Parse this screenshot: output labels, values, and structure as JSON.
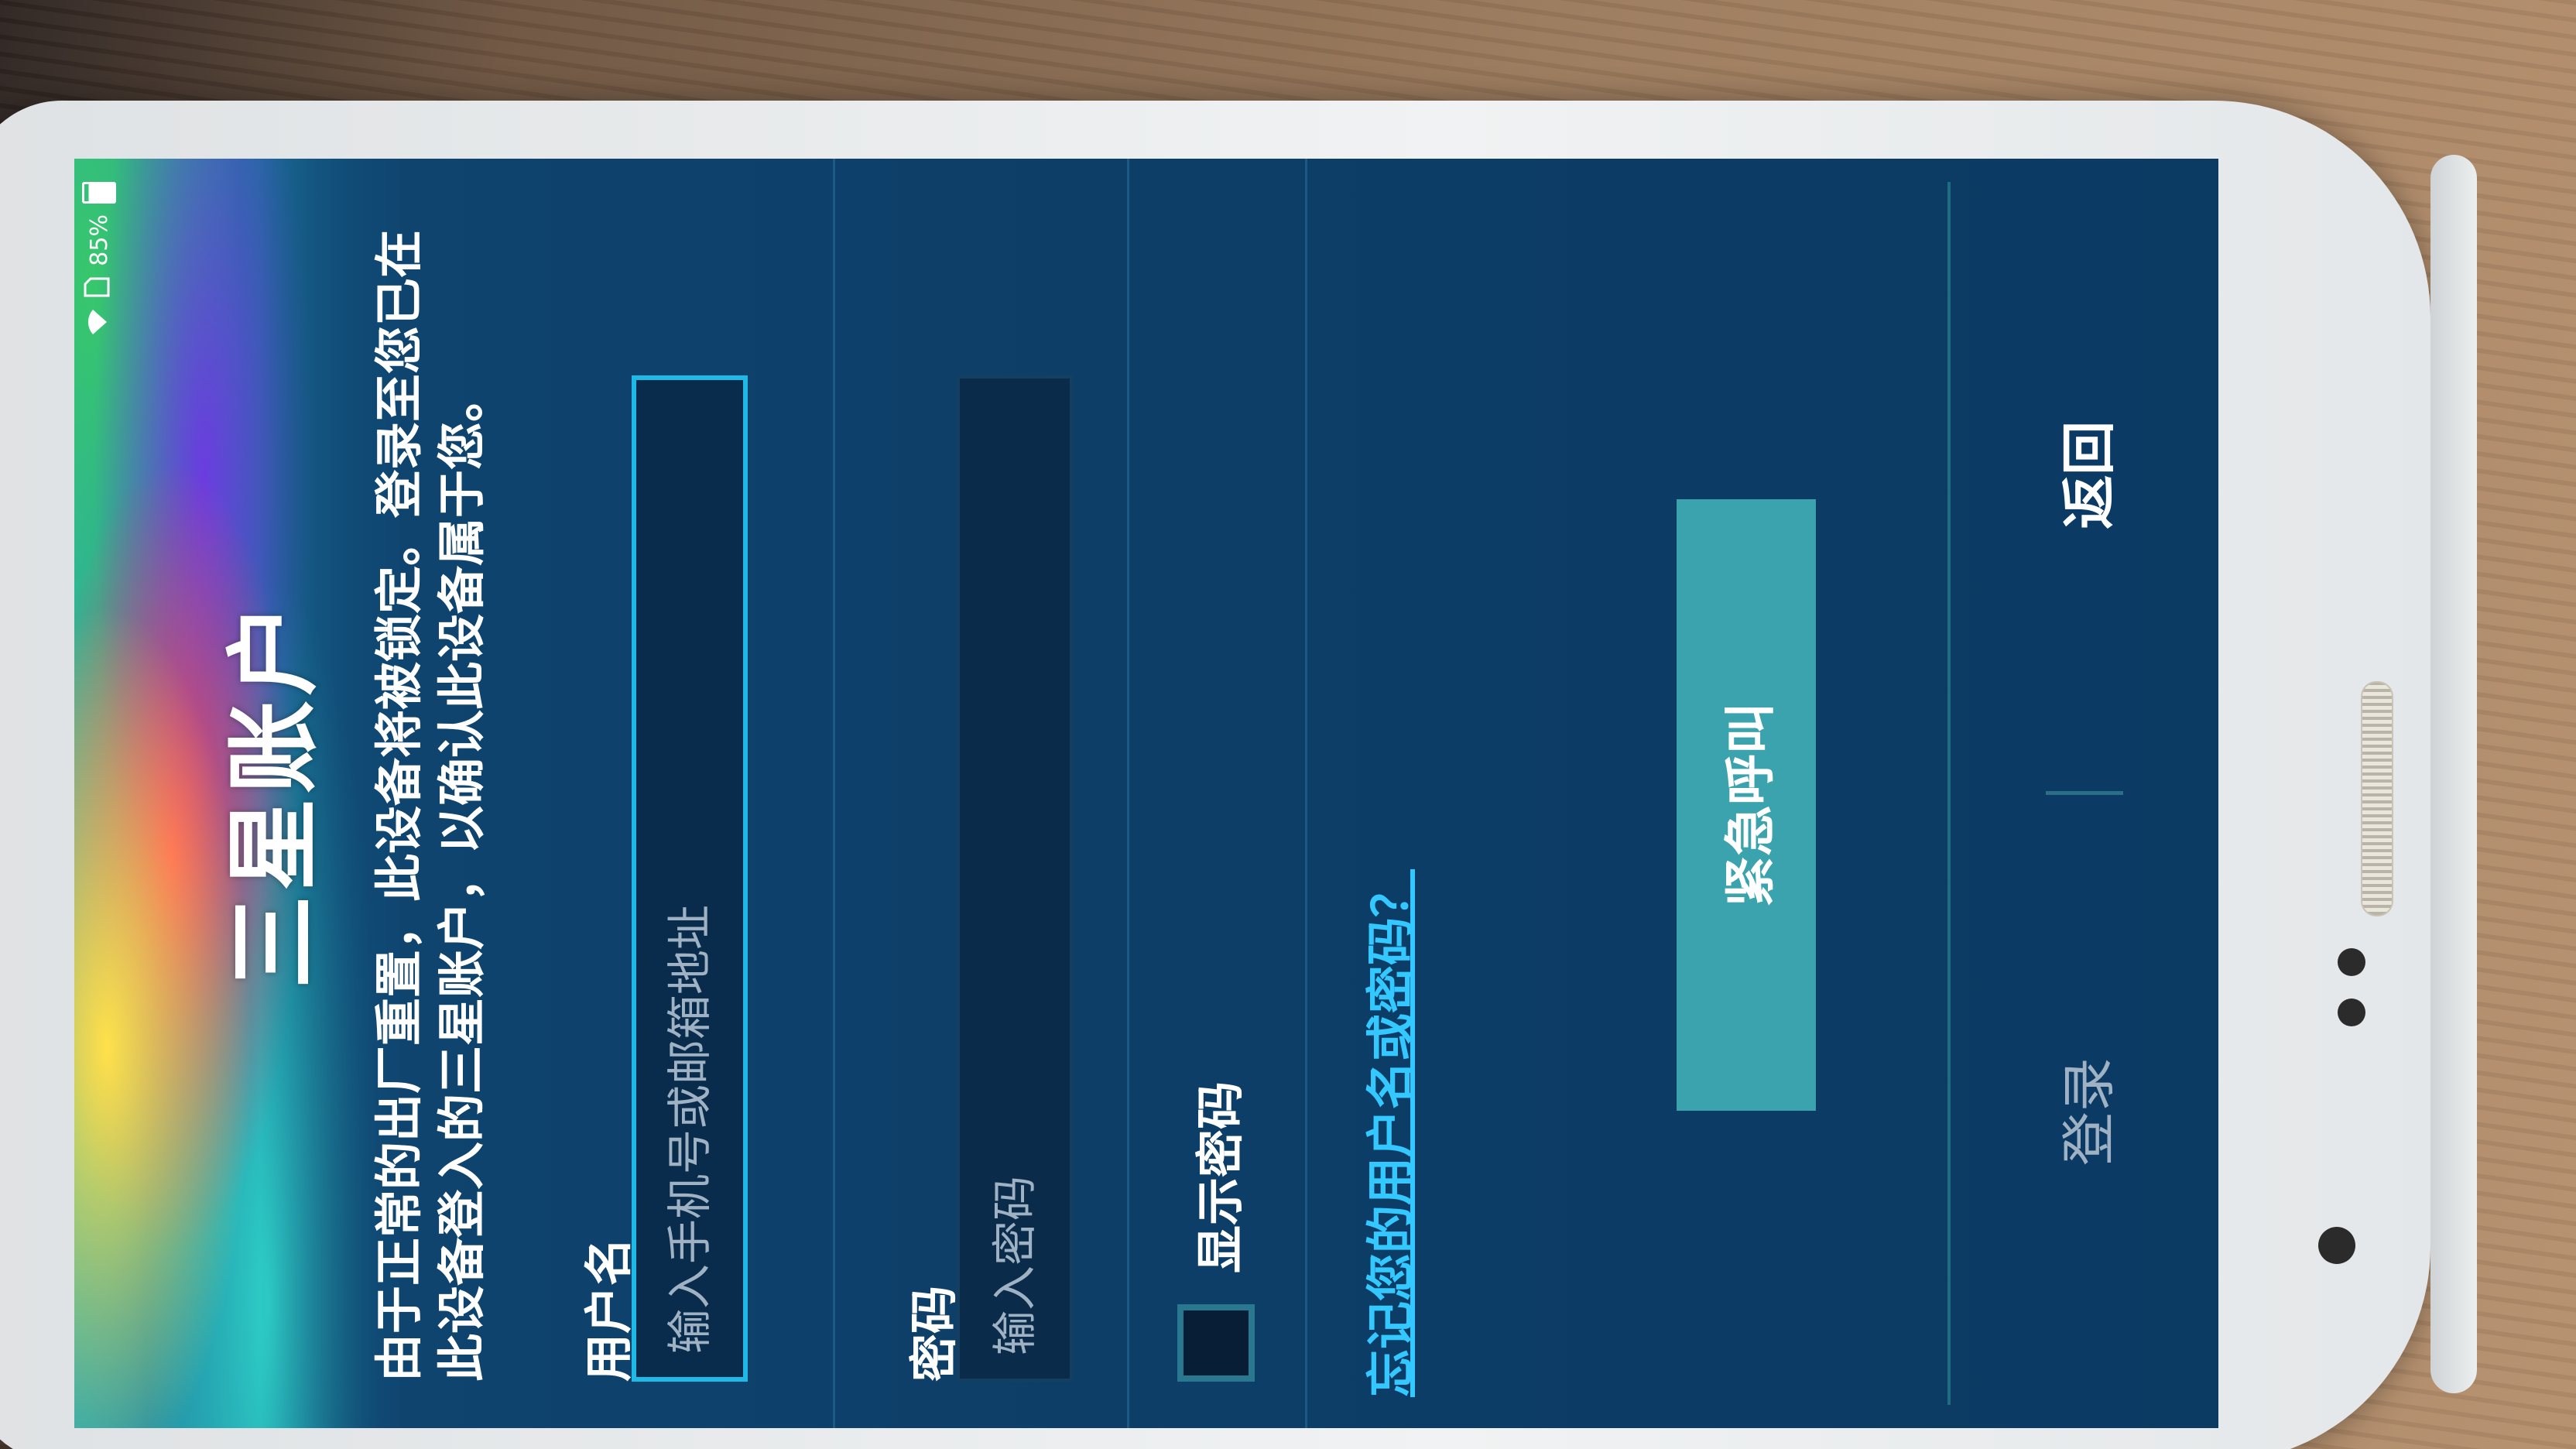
{
  "status_bar": {
    "battery_percent": "85%",
    "wifi_icon": "wifi-icon",
    "sim_icon": "sim-card-icon",
    "battery_icon": "battery-icon"
  },
  "header": {
    "title": "三星账户"
  },
  "intro": {
    "text": "由于正常的出厂重置，此设备将被锁定。登录至您已在此设备登入的三星账户，以确认此设备属于您。"
  },
  "form": {
    "username_label": "用户名",
    "username_placeholder": "输入手机号或邮箱地址",
    "password_label": "密码",
    "password_placeholder": "输入密码",
    "show_password_label": "显示密码",
    "show_password_checked": false,
    "forgot_link": "忘记您的用户名或密码？"
  },
  "emergency_button": "紧急呼叫",
  "bottom_bar": {
    "back_label": "返回",
    "login_label": "登录"
  },
  "colors": {
    "background": "#0e3f6a",
    "accent_link": "#33c8ff",
    "input_focus_border": "#1eb9e6",
    "emergency_button": "#3aa3ae"
  }
}
